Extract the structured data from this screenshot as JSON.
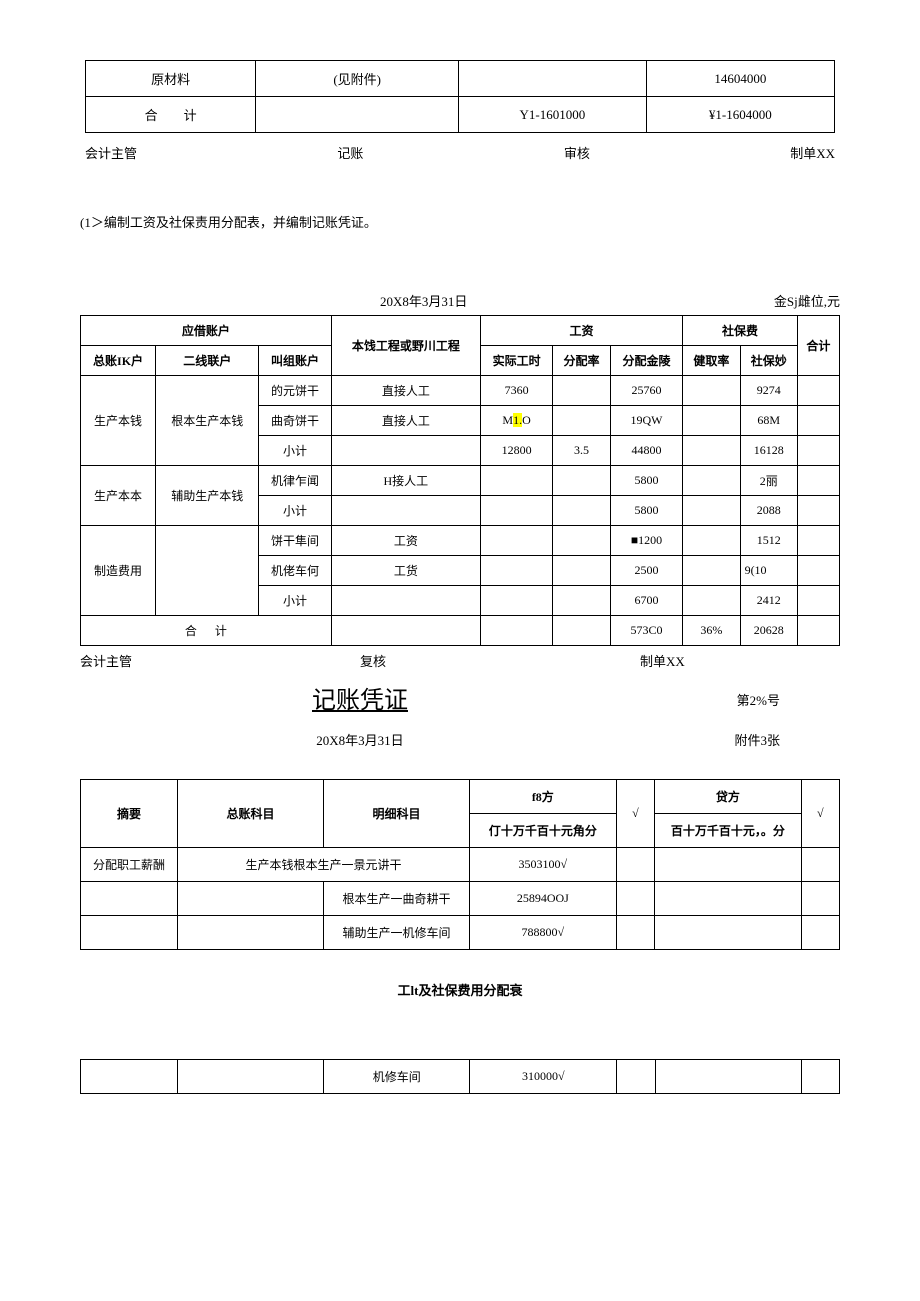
{
  "top": {
    "r1c1": "原材料",
    "r1c2": "(见附件)",
    "r1c3": "",
    "r1c4": "14604000",
    "r2c1": "合",
    "r2c2": "计",
    "r2c3": "Y1-1601000",
    "r2c4": "¥1-1604000"
  },
  "sig1": {
    "a": "会计主管",
    "b": "记账",
    "c": "审核",
    "d": "制单XX"
  },
  "note": "(1＞编制工资及社保责用分配表，并编制记账凭证。",
  "alloc_head": {
    "date": "20X8年3月31日",
    "unit": "金Sj雌位,元"
  },
  "alloc": {
    "h_account": "应借账户",
    "h_project": "本饯工程或野川工程",
    "h_wage": "工资",
    "h_social": "社保费",
    "h_total": "合计",
    "h_ledger": "总账IK户",
    "h_second": "二线联户",
    "h_detail": "叫组账户",
    "h_hours": "实际工时",
    "h_rate": "分配率",
    "h_amount": "分配金陵",
    "h_srate": "健取率",
    "h_samount": "社保妙",
    "rows": [
      {
        "a": "生产本钱",
        "b": "根本生产本钱",
        "c": "的元饼干",
        "d": "直接人工",
        "e": "7360",
        "f": "",
        "g": "25760",
        "h": "",
        "i": "9274",
        "j": ""
      },
      {
        "a": "",
        "b": "",
        "c": "曲奇饼干",
        "d": "直接人工",
        "e": "M1.O",
        "f": "",
        "g": "19QW",
        "h": "",
        "i": "68M",
        "j": ""
      },
      {
        "a": "",
        "b": "",
        "c": "小计",
        "d": "",
        "e": "12800",
        "f": "3.5",
        "g": "44800",
        "h": "",
        "i": "16128",
        "j": ""
      },
      {
        "a": "生产本本",
        "b": "辅助生产本钱",
        "c": "机律乍闻",
        "d": "H接人工",
        "e": "",
        "f": "",
        "g": "5800",
        "h": "",
        "i": "2丽",
        "j": ""
      },
      {
        "a": "",
        "b": "",
        "c": "小计",
        "d": "",
        "e": "",
        "f": "",
        "g": "5800",
        "h": "",
        "i": "2088",
        "j": ""
      },
      {
        "a": "制造费用",
        "b": "",
        "c": "饼干隼间",
        "d": "工资",
        "e": "",
        "f": "",
        "g": "■1200",
        "h": "",
        "i": "1512",
        "j": ""
      },
      {
        "a": "",
        "b": "",
        "c": "机佬车何",
        "d": "工货",
        "e": "",
        "f": "",
        "g": "2500",
        "h": "",
        "i": "9(10",
        "j": ""
      },
      {
        "a": "",
        "b": "",
        "c": "小计",
        "d": "",
        "e": "",
        "f": "",
        "g": "6700",
        "h": "",
        "i": "2412",
        "j": ""
      }
    ],
    "total_label1": "合",
    "total_label2": "计",
    "total_g": "573C0",
    "total_h": "36%",
    "total_i": "20628"
  },
  "sig2": {
    "a": "会计主管",
    "b": "复核",
    "c": "制单XX"
  },
  "voucher": {
    "title": "记账凭证",
    "no": "第2%号",
    "date": "20X8年3月31日",
    "attach": "附件3张",
    "h_summary": "摘要",
    "h_ledger": "总账科目",
    "h_detail": "明细科目",
    "h_debit": "f8方",
    "h_debit2": "仃十万千百十元角分",
    "h_check1": "√",
    "h_credit": "贷方",
    "h_credit2": "百十万千百十元，。分",
    "h_check2": "√",
    "rows": [
      {
        "a": "分配职工薪酬",
        "b": "生产本钱根本生产一景元讲干",
        "c": "",
        "d": "3503100√",
        "e": ""
      },
      {
        "a": "",
        "b": "",
        "c": "根本生产一曲奇耕干",
        "d": "25894OOJ",
        "e": ""
      },
      {
        "a": "",
        "b": "",
        "c": "辅助生产一机修车间",
        "d": "788800√",
        "e": ""
      }
    ]
  },
  "subtitle": "工lt及社保费用分配衰",
  "last": {
    "c": "机修车间",
    "d": "310000√"
  }
}
